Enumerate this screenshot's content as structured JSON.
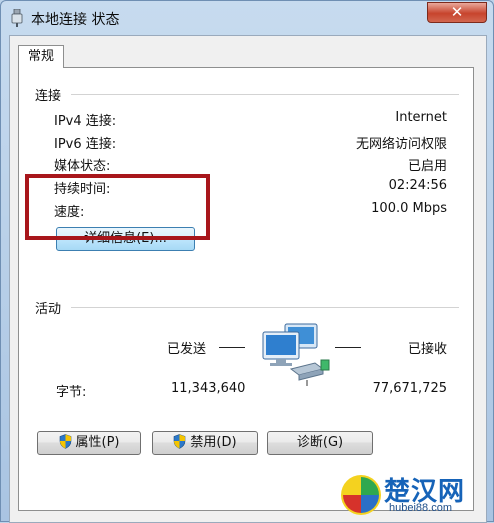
{
  "window": {
    "title": "本地连接 状态",
    "close_glyph": "✕"
  },
  "tabs": [
    {
      "label": "常规"
    }
  ],
  "connection": {
    "heading": "连接",
    "rows": [
      {
        "label": "IPv4 连接:",
        "value": "Internet"
      },
      {
        "label": "IPv6 连接:",
        "value": "无网络访问权限"
      },
      {
        "label": "媒体状态:",
        "value": "已启用"
      },
      {
        "label": "持续时间:",
        "value": "02:24:56"
      },
      {
        "label": "速度:",
        "value": "100.0 Mbps"
      }
    ],
    "details_button": "详细信息(E)..."
  },
  "activity": {
    "heading": "活动",
    "sent_label": "已发送",
    "received_label": "已接收",
    "bytes_label": "字节:",
    "bytes_sent": "11,343,640",
    "bytes_received": "77,671,725"
  },
  "buttons": {
    "properties": "属性(P)",
    "disable": "禁用(D)",
    "diagnose": "诊断(G)"
  },
  "watermark": {
    "text": "楚汉网",
    "url": "hubei88.com"
  },
  "colors": {
    "highlight_box": "#a8161b",
    "titlebar": "#c7dbef",
    "close_button": "#c7442d"
  },
  "icons": {
    "title": "network-adapter-icon",
    "activity": "network-computers-icon",
    "uac": "uac-shield-icon"
  }
}
